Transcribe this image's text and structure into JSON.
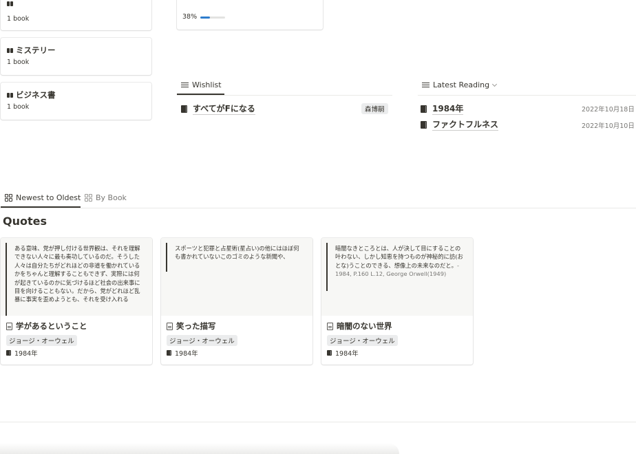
{
  "categories": [
    {
      "title": "",
      "count": "1 book"
    },
    {
      "title": "ミステリー",
      "count": "1 book"
    },
    {
      "title": "ビジネス書",
      "count": "1 book"
    }
  ],
  "reading_card": {
    "title": "",
    "progress_label": "38%",
    "progress": 0.38
  },
  "wishlist": {
    "tab_label": "Wishlist",
    "items": [
      {
        "title": "すべてがFになる",
        "author": "森博嗣"
      }
    ]
  },
  "latest_reading": {
    "tab_label": "Latest Reading",
    "items": [
      {
        "title": "1984年",
        "date": "2022年10月18日"
      },
      {
        "title": "ファクトフルネス",
        "date": "2022年10月10日"
      }
    ]
  },
  "quotes_view_tabs": [
    "Newest to Oldest",
    "By Book"
  ],
  "quotes_heading": "Quotes",
  "quotes": [
    {
      "text": "ある意味、党が押し付ける世界観は、それを理解できない人々に最も奏功しているのだ。そうした人々は自分たちがどれほどの非道を働かれているかをちゃんと理解することもできず、実際には何が起きているのかに気づけるほど社会の出来事に目を向けることもない。だから、党がどれほど乱暴に事実を歪めようとも、それを受け入れる",
      "title": "学があるということ",
      "author": "ジョージ・オーウェル",
      "book": "1984年"
    },
    {
      "text": "スポーツと犯罪と占星術(星占い)の他にはほぼ何も書かれていないこのゴミのような新聞や、",
      "title": "笑った描写",
      "author": "ジョージ・オーウェル",
      "book": "1984年"
    },
    {
      "text": "暗闇なきところとは、人が決して目にすることの叶わない、しかし知恵を持つものが神秘的に訪(おとな)うことのできる、想像上の未来なのだと。",
      "citation": "- 1984, P.160 L.12, George Orwell(1949)",
      "title": "暗闇のない世界",
      "author": "ジョージ・オーウェル",
      "book": "1984年"
    }
  ]
}
